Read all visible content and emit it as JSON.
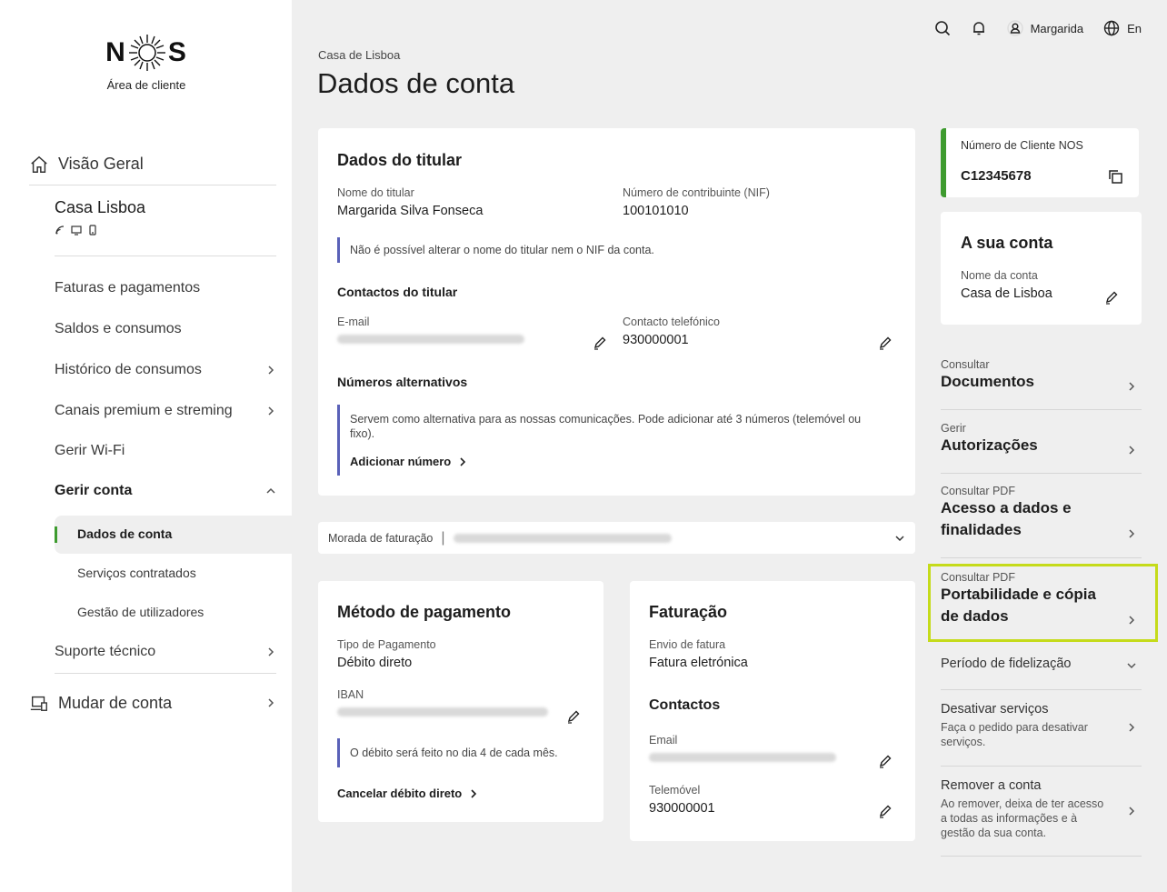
{
  "brand": {
    "logo_text_left": "N",
    "logo_text_right": "S",
    "subtitle": "Área de cliente"
  },
  "topbar": {
    "user_name": "Margarida",
    "language": "En"
  },
  "sidebar": {
    "overview": "Visão Geral",
    "account_name": "Casa Lisboa",
    "items": [
      {
        "label": "Faturas e pagamentos"
      },
      {
        "label": "Saldos e consumos"
      },
      {
        "label": "Histórico de consumos"
      },
      {
        "label": "Canais premium e streming"
      },
      {
        "label": "Gerir Wi-Fi"
      },
      {
        "label": "Gerir conta"
      }
    ],
    "sub_items": [
      {
        "label": "Dados de conta"
      },
      {
        "label": "Serviços contratados"
      },
      {
        "label": "Gestão de utilizadores"
      }
    ],
    "support": "Suporte técnico",
    "switch_account": "Mudar de conta"
  },
  "breadcrumb": "Casa de Lisboa",
  "page_title": "Dados de conta",
  "holder": {
    "title": "Dados do titular",
    "name_label": "Nome do titular",
    "name_value": "Margarida Silva Fonseca",
    "nif_label": "Número de contribuinte (NIF)",
    "nif_value": "100101010",
    "note": "Não é possível alterar o nome do titular nem o NIF da conta.",
    "contacts_title": "Contactos do titular",
    "email_label": "E-mail",
    "phone_label": "Contacto telefónico",
    "phone_value": "930000001",
    "alt_title": "Números alternativos",
    "alt_note": "Servem como alternativa para as nossas comunicações. Pode adicionar até 3 números (telemóvel ou fixo).",
    "add_number": "Adicionar número"
  },
  "billing_address": {
    "label": "Morada de faturação"
  },
  "payment": {
    "title": "Método de pagamento",
    "type_label": "Tipo de Pagamento",
    "type_value": "Débito direto",
    "iban_label": "IBAN",
    "note": "O débito será feito no dia 4 de cada mês.",
    "cancel": "Cancelar débito direto"
  },
  "invoicing": {
    "title": "Faturação",
    "send_label": "Envio de fatura",
    "send_value": "Fatura eletrónica",
    "contacts_title": "Contactos",
    "email_label": "Email",
    "phone_label": "Telemóvel",
    "phone_value": "930000001"
  },
  "client_number": {
    "label": "Número de Cliente NOS",
    "value": "C12345678"
  },
  "your_account": {
    "title": "A sua conta",
    "name_label": "Nome da conta",
    "name_value": "Casa de Lisboa"
  },
  "right_links": [
    {
      "small": "Consultar",
      "big": "Documentos"
    },
    {
      "small": "Gerir",
      "big": "Autorizações"
    },
    {
      "small": "Consultar PDF",
      "big": "Acesso a dados e finalidades"
    },
    {
      "small": "Consultar PDF",
      "big": "Portabilidade e cópia de dados"
    }
  ],
  "loyalty": "Período de fidelização",
  "deactivate": {
    "title": "Desativar serviços",
    "desc": "Faça o pedido para desativar serviços."
  },
  "remove": {
    "title": "Remover a conta",
    "desc": "Ao remover, deixa de ter acesso a todas as informações e à gestão da sua conta."
  },
  "colors": {
    "accent_green": "#3e9b2f",
    "note_bar": "#5a61b8",
    "highlight": "#c5db1a"
  }
}
